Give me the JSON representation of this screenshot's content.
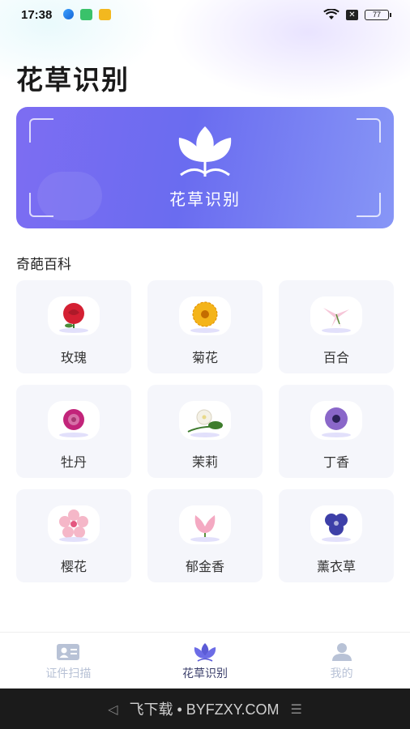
{
  "status": {
    "time": "17:38",
    "battery": "77"
  },
  "page": {
    "title": "花草识别"
  },
  "hero": {
    "label": "花草识别"
  },
  "section": {
    "title": "奇葩百科"
  },
  "flowers": [
    {
      "name": "玫瑰",
      "color": "#d42033"
    },
    {
      "name": "菊花",
      "color": "#f4b41a"
    },
    {
      "name": "百合",
      "color": "#f6c6d8"
    },
    {
      "name": "牡丹",
      "color": "#c2247a"
    },
    {
      "name": "茉莉",
      "color": "#f4f1e6"
    },
    {
      "name": "丁香",
      "color": "#8a67c9"
    },
    {
      "name": "樱花",
      "color": "#f5b7c8"
    },
    {
      "name": "郁金香",
      "color": "#f4a9c2"
    },
    {
      "name": "薰衣草",
      "color": "#3d3fa8"
    }
  ],
  "tabbar": {
    "tabs": [
      {
        "label": "证件扫描",
        "icon": "id-card-icon",
        "active": false
      },
      {
        "label": "花草识别",
        "icon": "flower-icon",
        "active": true
      },
      {
        "label": "我的",
        "icon": "person-icon",
        "active": false
      }
    ]
  },
  "navbar": {
    "watermark": "飞下载 • BYFZXY.COM"
  },
  "colors": {
    "accent": "#6a6cf0",
    "card_bg": "#f5f6fb",
    "tab_inactive": "#b8c2d6",
    "tab_active": "#3b3f6b"
  }
}
